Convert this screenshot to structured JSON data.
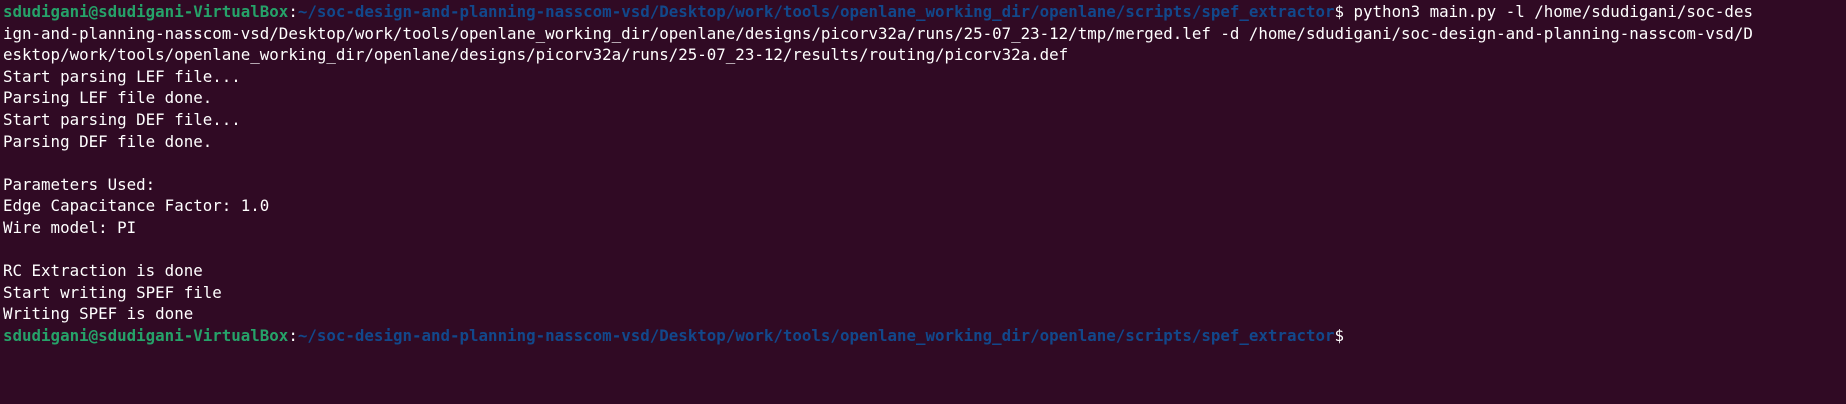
{
  "prompt": {
    "user_host": "sdudigani@sdudigani-VirtualBox",
    "colon": ":",
    "cwd": "~/soc-design-and-planning-nasscom-vsd/Desktop/work/tools/openlane_working_dir/openlane/scripts/spef_extractor",
    "symbol": "$"
  },
  "command": {
    "text": " python3 main.py -l /home/sdudigani/soc-des",
    "wrap": [
      "ign-and-planning-nasscom-vsd/Desktop/work/tools/openlane_working_dir/openlane/designs/picorv32a/runs/25-07_23-12/tmp/merged.lef -d /home/sdudigani/soc-design-and-planning-nasscom-vsd/D",
      "esktop/work/tools/openlane_working_dir/openlane/designs/picorv32a/runs/25-07_23-12/results/routing/picorv32a.def"
    ]
  },
  "output": [
    "Start parsing LEF file...",
    "Parsing LEF file done.",
    "Start parsing DEF file...",
    "Parsing DEF file done.",
    "",
    "Parameters Used:",
    "Edge Capacitance Factor: 1.0",
    "Wire model: PI",
    "",
    "RC Extraction is done",
    "Start writing SPEF file",
    "Writing SPEF is done"
  ],
  "colors": {
    "background": "#300a24",
    "user_host": "#26a269",
    "path": "#12488b",
    "text": "#ffffff"
  }
}
